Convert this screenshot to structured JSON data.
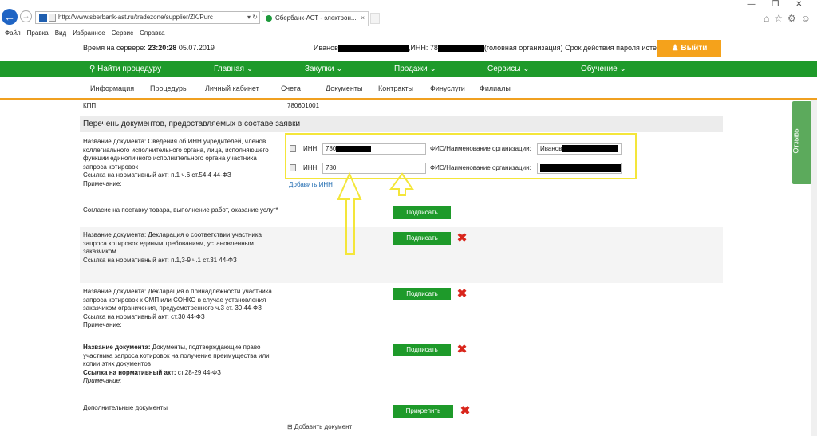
{
  "browser": {
    "url": "http://www.sberbank-ast.ru/tradezone/supplier/ZK/Purc",
    "tab_title": "Сбербанк-АСТ - электрон...",
    "menu": [
      "Файл",
      "Правка",
      "Вид",
      "Избранное",
      "Сервис",
      "Справка"
    ]
  },
  "header": {
    "server_label": "Время на сервере:",
    "server_time": "23:20:28",
    "server_date": "05.07.2019",
    "user_name": "Иванов",
    "inn_label": ",ИНН: 78",
    "org_status": "(головная организация) Срок действия пароля истек",
    "exit_label": "Выйти"
  },
  "main_nav": {
    "search": "Найти процедуру",
    "items": [
      "Главная",
      "Закупки",
      "Продажи",
      "Сервисы",
      "Обучение"
    ]
  },
  "sub_nav": [
    "Информация",
    "Процедуры",
    "Личный кабинет",
    "Счета",
    "Документы",
    "Контракты",
    "Финуслуги",
    "Филиалы"
  ],
  "form": {
    "kpp_label": "КПП",
    "kpp_value": "780601001",
    "section_title": "Перечень документов, предоставляемых в составе заявки",
    "doc1": {
      "line1": "Название документа:  Сведения об ИНН учредителей, членов",
      "line2": "коллегиального исполнительного органа, лица, исполняющего",
      "line3": "функции единоличного исполнительного органа участника",
      "line4": "запроса котировок",
      "norm": "Ссылка на нормативный акт:  п.1 ч.6 ст.54.4 44-ФЗ",
      "note": "Примечание:"
    },
    "inn_rows": [
      {
        "inn_label": "ИНН:",
        "inn_value": "780",
        "fio_label": "ФИО/Наименование организации:",
        "fio_value": "Иванов"
      },
      {
        "inn_label": "ИНН:",
        "inn_value": "780",
        "fio_label": "ФИО/Наименование организации:",
        "fio_value": ""
      }
    ],
    "add_inn": "Добавить ИНН",
    "consent": "Согласие на поставку товара, выполнение работ, оказание услуг*",
    "sign_label": "Подписать",
    "doc2": {
      "line1": "Название документа:  Декларация о соответствии участника",
      "line2": "запроса котировок единым требованиям, установленным",
      "line3": "заказчиком",
      "norm": "Ссылка на нормативный акт:  п.1,3-9 ч.1 ст.31 44-ФЗ"
    },
    "doc3": {
      "line1": "Название документа:  Декларация о принадлежности участника",
      "line2": "запроса котировок к СМП или СОНКО в случае установления",
      "line3": "заказчиком ограничения, предусмотренного ч.3 ст. 30 44-ФЗ",
      "norm": "Ссылка на нормативный акт:  ст.30 44-ФЗ",
      "note": "Примечание:"
    },
    "doc4": {
      "title_label": "Название документа:",
      "line1": " Документы, подтверждающие право",
      "line2": "участника запроса котировок на получение преимущества или",
      "line3": "копии этих документов",
      "norm_label": "Ссылка на нормативный акт:",
      "norm_value": " ст.28-29 44-ФЗ",
      "note": "Примечание:"
    },
    "extra_docs": "Дополнительные документы",
    "attach_label": "Прикрепить",
    "add_doc": "Добавить документ"
  },
  "feedback_label": "Отзывы"
}
